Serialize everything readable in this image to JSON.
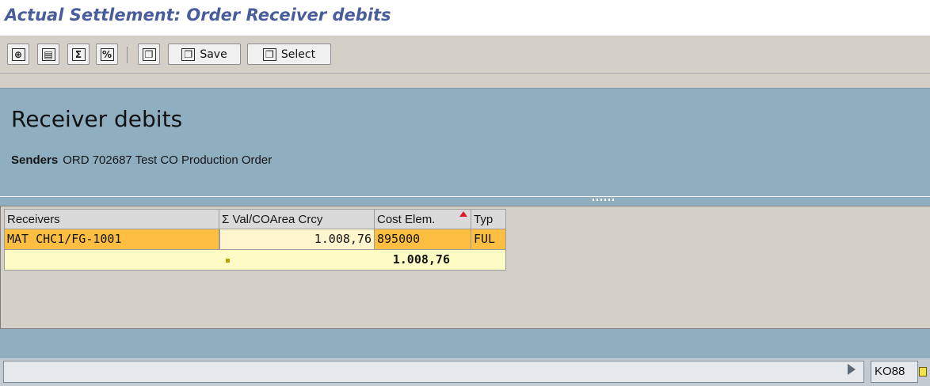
{
  "title": "Actual Settlement: Order Receiver debits",
  "toolbar": {
    "buttons": [
      {
        "icon": "detail-icon",
        "glyph": "⊕"
      },
      {
        "icon": "columns-icon",
        "glyph": "▤"
      },
      {
        "icon": "sum-icon",
        "glyph": "Σ"
      },
      {
        "icon": "subtotal-icon",
        "glyph": "%"
      },
      {
        "icon": "layout-icon",
        "glyph": "❐"
      },
      {
        "icon": "save-layout-icon",
        "glyph": "❐",
        "label": "Save"
      },
      {
        "icon": "select-layout-icon",
        "glyph": "❐",
        "label": "Select"
      }
    ]
  },
  "header": {
    "heading": "Receiver debits",
    "senders_label": "Senders",
    "senders_value": "ORD 702687 Test CO Production Order"
  },
  "grid": {
    "columns": [
      {
        "label": "Receivers"
      },
      {
        "label": "Σ    Val/COArea Crcy"
      },
      {
        "label": "Cost Elem."
      },
      {
        "label": "Typ"
      }
    ],
    "rows": [
      {
        "receiver": "MAT CHC1/FG-1001",
        "value": "1.008,76",
        "cost_element": "895000",
        "type": "FUL"
      }
    ],
    "total": {
      "value": "1.008,76"
    }
  },
  "status": {
    "tcode": "KO88"
  },
  "colors": {
    "title": "#4a5d9b",
    "header_bg": "#8fafc1",
    "selected_row": "#fdbe42",
    "total_row": "#fffbc5",
    "sort_marker": "#e01a2a"
  }
}
